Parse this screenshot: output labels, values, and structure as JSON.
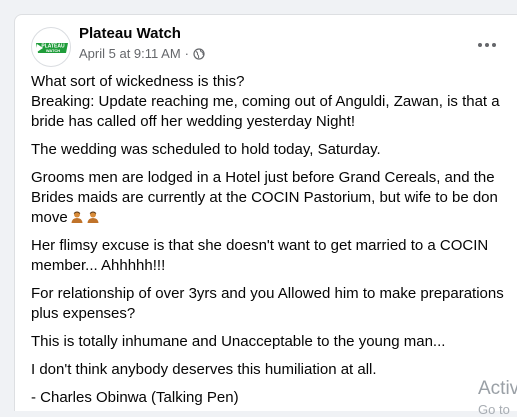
{
  "post": {
    "author": "Plateau Watch",
    "avatar_text_top": "PLATEAU",
    "avatar_text_bottom": "WATCH",
    "date": "April 5 at 9:11 AM",
    "separator": "·",
    "privacy_icon": "globe-icon",
    "more_icon": "more-options-icon",
    "paragraphs": {
      "p0_line0": "What sort of wickedness is this?",
      "p0_line1": "Breaking: Update reaching me, coming out of Anguldi, Zawan,  is that a bride has called off her wedding yesterday Night!",
      "p1": "The wedding was scheduled to hold today, Saturday.",
      "p2": "Grooms men are lodged in a Hotel just before Grand Cereals, and the Brides maids are currently at the COCIN  Pastorium, but wife to be don move",
      "p3": "Her flimsy excuse is that she doesn't want to get married to a COCIN member... Ahhhhh!!!",
      "p4": "For relationship of over 3yrs and you Allowed him to make preparations plus expenses?",
      "p5": "This is totally inhumane and Unacceptable to the young man...",
      "p6": "I don't think anybody deserves this humiliation at all.",
      "p7": "- Charles Obinwa (Talking Pen)"
    },
    "emoji_icons": [
      "person-shrugging-icon",
      "person-shrugging-icon"
    ]
  },
  "watermark": {
    "line1": "Activ",
    "line2": "Go to"
  },
  "colors": {
    "brand_green": "#1f9d3a",
    "secondary_text": "#65676b",
    "background": "#f0f2f5"
  }
}
